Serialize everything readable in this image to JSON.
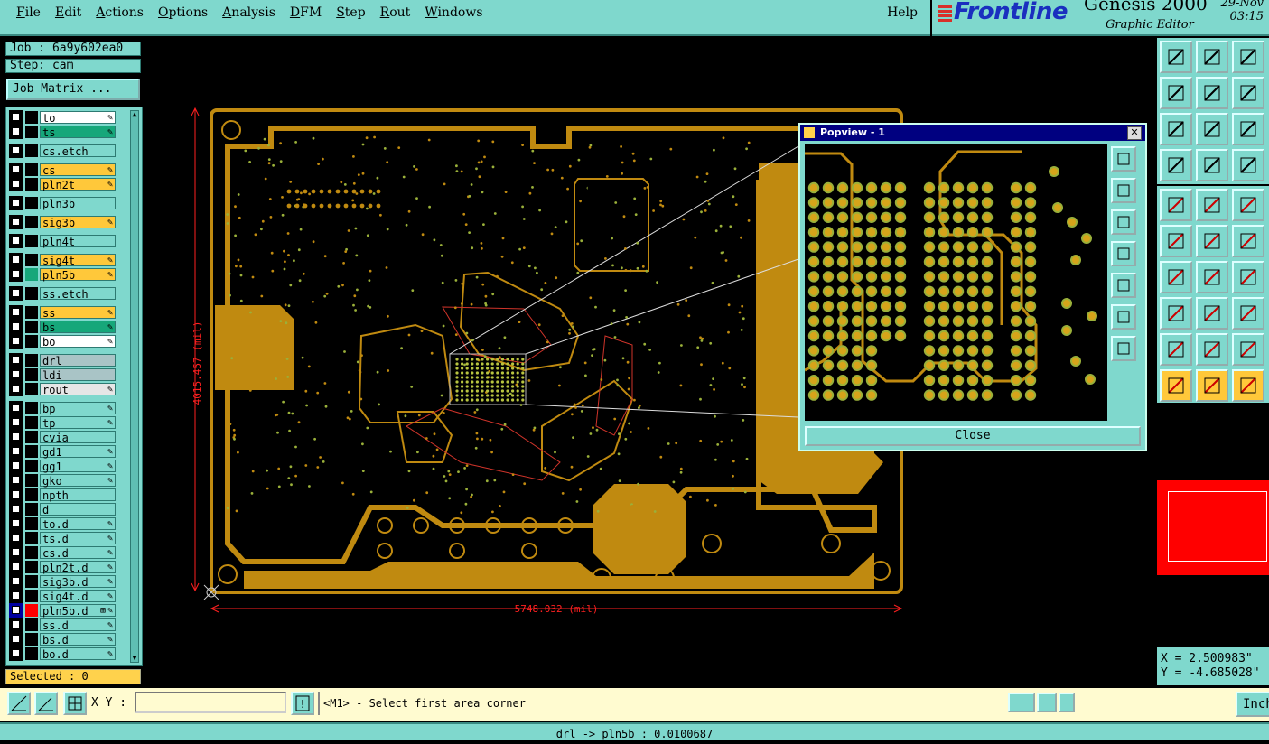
{
  "menubar": {
    "items": [
      "File",
      "Edit",
      "Actions",
      "Options",
      "Analysis",
      "DFM",
      "Step",
      "Rout",
      "Windows"
    ],
    "help": "Help"
  },
  "brand": {
    "logo": "Frontline",
    "product": "Genesis 2000",
    "subtitle": "Graphic Editor",
    "date": "29-Nov",
    "time": "03:15"
  },
  "job": {
    "job_label": "Job : 6a9y602ea0",
    "step_label": "Step: cam",
    "matrix_button": "Job Matrix ..."
  },
  "layers": [
    {
      "name": "to",
      "bg": "#ffffff",
      "pen": true
    },
    {
      "name": "ts",
      "bg": "#16a77a",
      "pen": true
    },
    {
      "gap": true
    },
    {
      "name": "cs.etch",
      "bg": "#7fd8cd",
      "pen": false
    },
    {
      "gap": true
    },
    {
      "name": "cs",
      "bg": "#ffc83a",
      "pen": true
    },
    {
      "name": "pln2t",
      "bg": "#ffc83a",
      "pen": true
    },
    {
      "gap": true
    },
    {
      "name": "pln3b",
      "bg": "#7fd8cd",
      "pen": false
    },
    {
      "gap": true
    },
    {
      "name": "sig3b",
      "bg": "#ffc83a",
      "pen": true
    },
    {
      "gap": true
    },
    {
      "name": "pln4t",
      "bg": "#7fd8cd",
      "pen": false
    },
    {
      "gap": true
    },
    {
      "name": "sig4t",
      "bg": "#ffc83a",
      "pen": true
    },
    {
      "name": "pln5b",
      "bg": "#ffc83a",
      "pen": true,
      "swatch": "#16a77a"
    },
    {
      "gap": true
    },
    {
      "name": "ss.etch",
      "bg": "#7fd8cd",
      "pen": false
    },
    {
      "gap": true
    },
    {
      "name": "ss",
      "bg": "#ffc83a",
      "pen": true
    },
    {
      "name": "bs",
      "bg": "#16a77a",
      "pen": true
    },
    {
      "name": "bo",
      "bg": "#ffffff",
      "pen": true
    },
    {
      "gap": true
    },
    {
      "name": "drl",
      "bg": "#a9c4c6",
      "pen": false
    },
    {
      "name": "ldi",
      "bg": "#a9c4c6",
      "pen": false
    },
    {
      "name": "rout",
      "bg": "#e6e6e6",
      "pen": true
    },
    {
      "gap": true
    },
    {
      "name": "bp",
      "bg": "#7fd8cd",
      "pen": true
    },
    {
      "name": "tp",
      "bg": "#7fd8cd",
      "pen": true
    },
    {
      "name": "cvia",
      "bg": "#7fd8cd",
      "pen": false
    },
    {
      "name": "gd1",
      "bg": "#7fd8cd",
      "pen": true
    },
    {
      "name": "gg1",
      "bg": "#7fd8cd",
      "pen": true
    },
    {
      "name": "gko",
      "bg": "#7fd8cd",
      "pen": true
    },
    {
      "name": "npth",
      "bg": "#7fd8cd",
      "pen": false
    },
    {
      "name": "d",
      "bg": "#7fd8cd",
      "pen": false
    },
    {
      "name": "to.d",
      "bg": "#7fd8cd",
      "pen": true
    },
    {
      "name": "ts.d",
      "bg": "#7fd8cd",
      "pen": true
    },
    {
      "name": "cs.d",
      "bg": "#7fd8cd",
      "pen": true
    },
    {
      "name": "pln2t.d",
      "bg": "#7fd8cd",
      "pen": true
    },
    {
      "name": "sig3b.d",
      "bg": "#7fd8cd",
      "pen": true
    },
    {
      "name": "sig4t.d",
      "bg": "#7fd8cd",
      "pen": true
    },
    {
      "name": "pln5b.d",
      "bg": "#7fd8cd",
      "pen": true,
      "swatch": "#ff0000",
      "active": true,
      "extra": true
    },
    {
      "name": "ss.d",
      "bg": "#7fd8cd",
      "pen": true
    },
    {
      "name": "bs.d",
      "bg": "#7fd8cd",
      "pen": true
    },
    {
      "name": "bo.d",
      "bg": "#7fd8cd",
      "pen": true
    }
  ],
  "selected_label": "Selected : 0",
  "canvas": {
    "dim_vertical": "4015.457 (mil)",
    "dim_horizontal": "5748.032 (mil)",
    "board_color": "#c08a10",
    "dim_color": "#ff2020"
  },
  "popview": {
    "title": "Popview - 1",
    "close_label": "Close"
  },
  "coords": {
    "x_label": "X = 2.500983\"",
    "y_label": "Y = -4.685028\""
  },
  "cmdbar": {
    "xy_label": "X Y :",
    "xy_value": "",
    "prompt": "<M1> - Select first area corner",
    "inch_button": "Inch"
  },
  "status": "drl -> pln5b : 0.0100687"
}
